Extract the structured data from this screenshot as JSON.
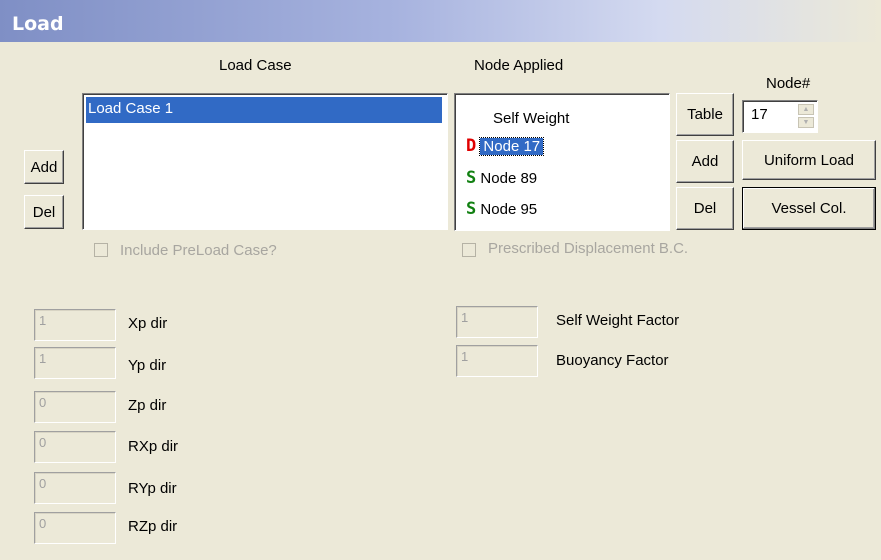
{
  "window": {
    "title": "Load"
  },
  "load_case": {
    "header": "Load Case",
    "items": [
      "Load Case 1"
    ],
    "add_label": "Add",
    "del_label": "Del"
  },
  "node_applied": {
    "header": "Node Applied",
    "items": [
      {
        "icon": "",
        "label": "Self Weight",
        "selected": false
      },
      {
        "icon": "D",
        "label": "Node 17",
        "selected": true
      },
      {
        "icon": "S",
        "label": "Node 89",
        "selected": false
      },
      {
        "icon": "S",
        "label": "Node 95",
        "selected": false
      }
    ],
    "table_label": "Table",
    "add_label": "Add",
    "del_label": "Del"
  },
  "node_number": {
    "label": "Node#",
    "value": "17"
  },
  "uniform_load_label": "Uniform Load",
  "vessel_col_label": "Vessel Col.",
  "include_preload": {
    "label": "Include PreLoad Case?",
    "checked": false
  },
  "prescribed_disp": {
    "label": "Prescribed Displacement B.C.",
    "checked": false
  },
  "directions": [
    {
      "value": "1",
      "label": "Xp dir"
    },
    {
      "value": "1",
      "label": "Yp dir"
    },
    {
      "value": "0",
      "label": "Zp dir"
    },
    {
      "value": "0",
      "label": "RXp dir"
    },
    {
      "value": "0",
      "label": "RYp dir"
    },
    {
      "value": "0",
      "label": "RZp dir"
    }
  ],
  "factors": [
    {
      "value": "1",
      "label": "Self Weight Factor"
    },
    {
      "value": "1",
      "label": "Buoyancy Factor"
    }
  ],
  "colors": {
    "selection": "#316ac5",
    "d_icon": "#e00000",
    "s_icon": "#118011"
  }
}
